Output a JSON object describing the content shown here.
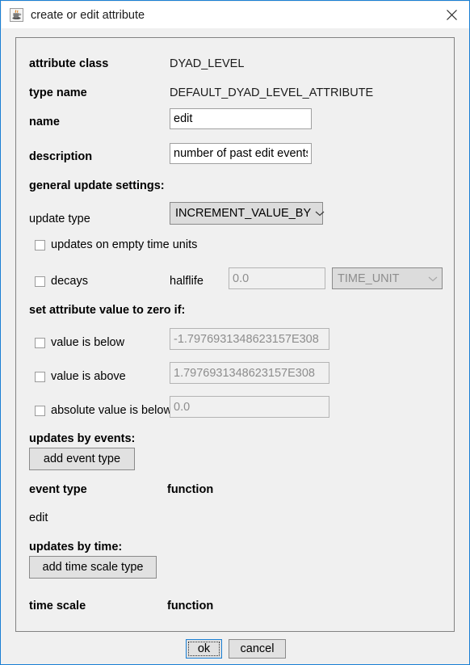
{
  "window": {
    "title": "create or edit attribute",
    "icon": "java-coffee-cup-icon",
    "close_icon": "close-icon",
    "accent_color": "#1a7fd4",
    "background_color": "#f0f0f0"
  },
  "fields": {
    "attribute_class": {
      "label": "attribute class",
      "value": "DYAD_LEVEL"
    },
    "type_name": {
      "label": "type name",
      "value": "DEFAULT_DYAD_LEVEL_ATTRIBUTE"
    },
    "name": {
      "label": "name",
      "value": "edit",
      "placeholder": ""
    },
    "description": {
      "label": "description",
      "value": "number of past edit events",
      "placeholder": ""
    }
  },
  "general_update_settings": {
    "heading": "general update settings:",
    "update_type": {
      "label": "update type",
      "selected": "INCREMENT_VALUE_BY",
      "chevron_icon": "chevron-down-icon",
      "enabled": true
    },
    "updates_on_empty_time_units": {
      "label": "updates on empty time units",
      "checked": false
    },
    "decays": {
      "label": "decays",
      "checked": false
    },
    "halflife": {
      "label": "halflife",
      "value": "0.0",
      "enabled": false
    },
    "time_unit": {
      "selected": "TIME_UNIT",
      "chevron_icon": "chevron-down-icon",
      "enabled": false
    }
  },
  "zero_conditions": {
    "heading": "set attribute value to zero if:",
    "rows": [
      {
        "label": "value is below",
        "checked": false,
        "value": "-1.7976931348623157E308",
        "enabled": false
      },
      {
        "label": "value is above",
        "checked": false,
        "value": "1.7976931348623157E308",
        "enabled": false
      },
      {
        "label": "absolute value is below",
        "checked": false,
        "value": "0.0",
        "enabled": false
      }
    ]
  },
  "updates_by_events": {
    "heading": "updates by events:",
    "add_button": "add event type",
    "columns": [
      "event type",
      "function"
    ],
    "rows": [
      {
        "event_type": "edit",
        "function": ""
      }
    ]
  },
  "updates_by_time": {
    "heading": "updates by time:",
    "add_button": "add time scale type",
    "columns": [
      "time scale",
      "function"
    ],
    "rows": []
  },
  "footer": {
    "ok_label": "ok",
    "cancel_label": "cancel"
  }
}
